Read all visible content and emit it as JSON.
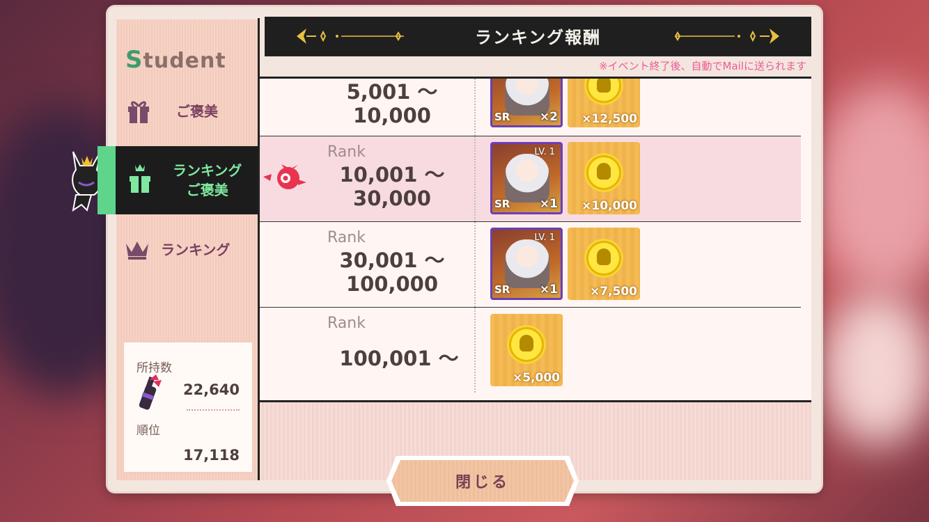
{
  "sidebar": {
    "logo": "Student",
    "items": [
      {
        "label": "ご褒美"
      },
      {
        "label_line1": "ランキング",
        "label_line2": "ご褒美"
      },
      {
        "label": "ランキング"
      }
    ],
    "stats": {
      "owned_label": "所持数",
      "owned_value": "22,640",
      "rank_label": "順位",
      "rank_value": "17,118"
    }
  },
  "header": {
    "title": "ランキング報酬",
    "note": "※イベント終了後、自動でMailに送られます"
  },
  "rows": [
    {
      "rank_label": "",
      "range_line1": "5,001 ～",
      "range_line2": "10,000",
      "rewards": [
        {
          "type": "sr",
          "qty": "×2"
        },
        {
          "type": "coin",
          "qty": "×12,500"
        }
      ]
    },
    {
      "rank_label": "Rank",
      "range_line1": "10,001 ～",
      "range_line2": "30,000",
      "rewards": [
        {
          "type": "sr",
          "lv": "LV. 1",
          "qty": "×1"
        },
        {
          "type": "coin",
          "qty": "×10,000"
        }
      ]
    },
    {
      "rank_label": "Rank",
      "range_line1": "30,001 ～",
      "range_line2": "100,000",
      "rewards": [
        {
          "type": "sr",
          "lv": "LV. 1",
          "qty": "×1"
        },
        {
          "type": "coin",
          "qty": "×7,500"
        }
      ]
    },
    {
      "rank_label": "Rank",
      "range_line1": "100,001 ～",
      "range_line2": "",
      "rewards": [
        {
          "type": "coin",
          "qty": "×5,000"
        }
      ]
    }
  ],
  "card_tag": "SR",
  "close_button": "閉じる",
  "colors": {
    "active_tab_bg": "#1c1c1c",
    "active_tab_text": "#7ee8a0",
    "note_pink": "#ee5b92",
    "highlight_row": "#f7dbe1"
  }
}
